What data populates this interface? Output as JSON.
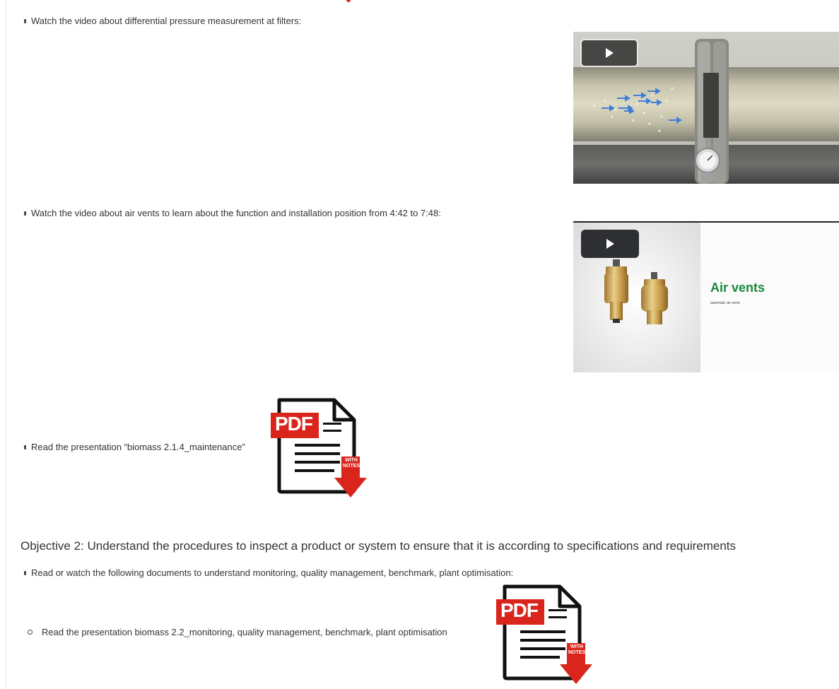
{
  "content": {
    "item1": "Watch the video about differential pressure measurement at filters:",
    "item2": "Watch the video about air vents to learn about the function and installation position from 4:42 to 7:48:",
    "item3": "Read the presentation “biomass 2.1.4_maintenance”",
    "objective_heading": "Objective 2: Understand the procedures to inspect a product or system to ensure that it is according to specifications and requirements",
    "item4": "Read or watch the following documents to understand monitoring, quality management, benchmark, plant optimisation:",
    "subitem1": "Read the presentation biomass 2.2_monitoring, quality management, benchmark, plant optimisation"
  },
  "video2": {
    "title": "Air vents",
    "subtitle": "automatic air vents"
  },
  "pdf_icon": {
    "label": "PDF",
    "badge_line1": "WITH",
    "badge_line2": "NOTES"
  },
  "colors": {
    "pdf_red": "#d9251c",
    "air_vents_green": "#1a8a3c",
    "text": "#333333"
  }
}
